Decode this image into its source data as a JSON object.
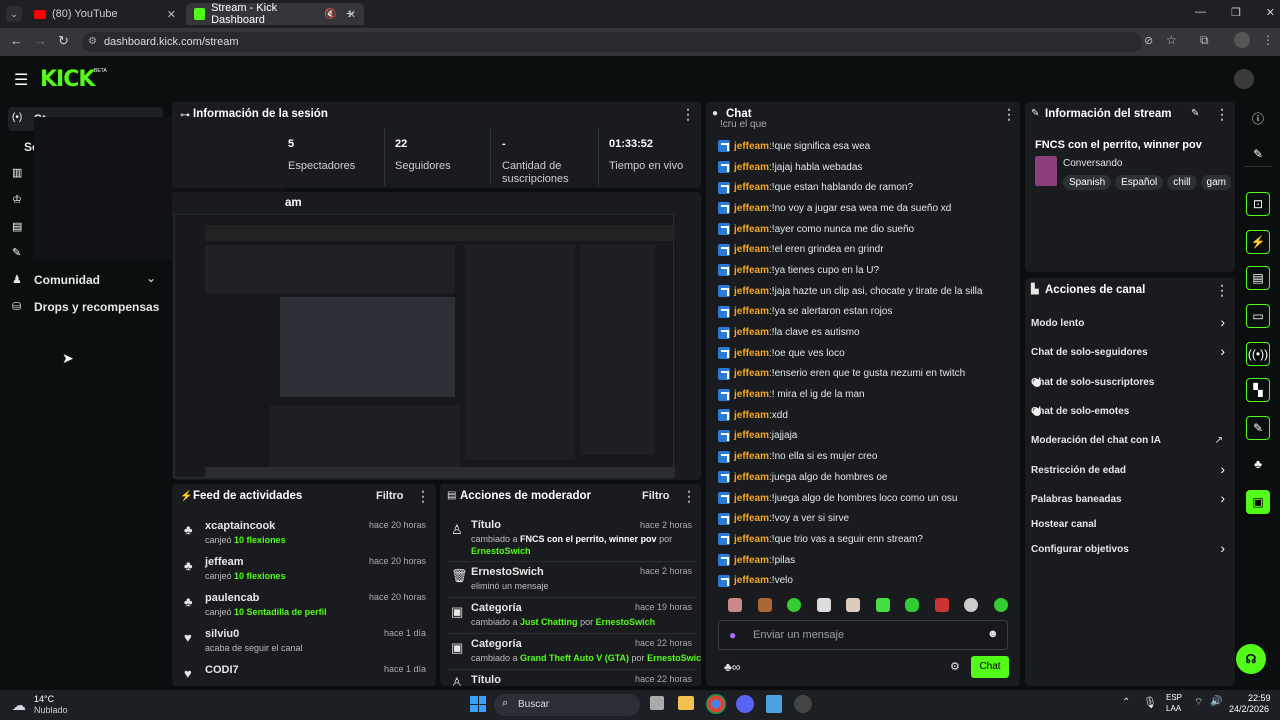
{
  "browser": {
    "tabs": [
      {
        "label": "(80) YouTube"
      },
      {
        "label": "Stream - Kick Dashboard"
      }
    ],
    "url": "dashboard.kick.com/stream"
  },
  "kick": {
    "logo": "KICK",
    "beta": "BETA"
  },
  "sidebar": {
    "items": [
      {
        "label": "St"
      },
      {
        "label": "Se"
      },
      {
        "label": "Comunidad"
      },
      {
        "label": "Drops y recompensas"
      }
    ]
  },
  "session": {
    "title": "Información de la sesión",
    "stats": [
      {
        "value": "5",
        "label": "Espectadores"
      },
      {
        "value": "22",
        "label": "Seguidores"
      },
      {
        "value": "-",
        "label": "Cantidad de suscripciones"
      },
      {
        "value": "01:33:52",
        "label": "Tiempo en vivo"
      }
    ],
    "stream_label": "am"
  },
  "feed": {
    "title": "Feed de actividades",
    "filter": "Filtro",
    "items": [
      {
        "name": "xcaptaincook",
        "action": "canjeó",
        "reward": "10 flexiones",
        "time": "hace 20 horas"
      },
      {
        "name": "jeffeam",
        "action": "canjeó",
        "reward": "10 flexiones",
        "time": "hace 20 horas"
      },
      {
        "name": "paulencab",
        "action": "canjeó",
        "reward": "10 Sentadilla de perfil",
        "time": "hace 20 horas"
      },
      {
        "name": "silviu0",
        "action": "acaba de seguir el canal",
        "reward": "",
        "time": "hace 1 día"
      },
      {
        "name": "CODI7",
        "action": "",
        "reward": "",
        "time": "hace 1 día"
      }
    ]
  },
  "mod": {
    "title": "Acciones de moderador",
    "filter": "Filtro",
    "items": [
      {
        "title": "Título",
        "time": "hace 2 horas",
        "line1": "cambiado a",
        "hl1": "FNCS con el perrito, winner pov",
        "mid": "por",
        "line2": "ErnestoSwich"
      },
      {
        "title": "ErnestoSwich",
        "time": "hace 2 horas",
        "line1": "eliminó un mensaje",
        "hl1": "",
        "mid": "",
        "line2": ""
      },
      {
        "title": "Categoría",
        "time": "hace 19 horas",
        "line1": "cambiado a",
        "hl1": "Just Chatting",
        "mid": "por",
        "line2": "ErnestoSwich"
      },
      {
        "title": "Categoría",
        "time": "hace 22 horas",
        "line1": "cambiado a",
        "hl1": "Grand Theft Auto V (GTA)",
        "mid": "por",
        "line2": "ErnestoSwich"
      },
      {
        "title": "Título",
        "time": "hace 22 horas",
        "line1": "",
        "hl1": "",
        "mid": "",
        "line2": ""
      }
    ]
  },
  "chat": {
    "title": "Chat",
    "first_partial": "!cru el que",
    "messages": [
      {
        "user": "jeffeam",
        "text": "!que significa esa wea"
      },
      {
        "user": "jeffeam",
        "text": "!jajaj habla webadas"
      },
      {
        "user": "jeffeam",
        "text": "!que estan hablando de ramon?"
      },
      {
        "user": "jeffeam",
        "text": "!no voy a jugar esa wea me da sueño xd"
      },
      {
        "user": "jeffeam",
        "text": "!ayer como nunca me dio sueño"
      },
      {
        "user": "jeffeam",
        "text": "!el eren grindea en grindr"
      },
      {
        "user": "jeffeam",
        "text": "!ya tienes cupo en la U?"
      },
      {
        "user": "jeffeam",
        "text": "!jaja hazte un clip asi, chocate y tirate de la silla"
      },
      {
        "user": "jeffeam",
        "text": "!ya se alertaron estan rojos"
      },
      {
        "user": "jeffeam",
        "text": "!la clave es autismo"
      },
      {
        "user": "jeffeam",
        "text": "!oe que ves loco"
      },
      {
        "user": "jeffeam",
        "text": "!enserio eren que te gusta nezumi en twitch"
      },
      {
        "user": "jeffeam",
        "text": "! mira el ig de la man"
      },
      {
        "user": "jeffeam",
        "text": "xdd"
      },
      {
        "user": "jeffeam",
        "text": "jajjaja"
      },
      {
        "user": "jeffeam",
        "text": "!no ella si es mujer creo"
      },
      {
        "user": "jeffeam",
        "text": "juega algo de hombres oe"
      },
      {
        "user": "jeffeam",
        "text": "!juega algo de hombres loco como un osu"
      },
      {
        "user": "jeffeam",
        "text": "!voy a ver si sirve"
      },
      {
        "user": "jeffeam",
        "text": "!que trio vas a seguir enn stream?"
      },
      {
        "user": "jeffeam",
        "text": "!pilas"
      },
      {
        "user": "jeffeam",
        "text": "!velo"
      }
    ],
    "placeholder": "Enviar un mensaje",
    "send": "Chat"
  },
  "streaminfo": {
    "title": "Información del stream",
    "stream_title": "FNCS con el perrito, winner pov",
    "category": "Conversando",
    "tags": [
      "Spanish",
      "Español",
      "chill",
      "gam"
    ]
  },
  "channel": {
    "title": "Acciones de canal",
    "items": [
      {
        "label": "Modo lento",
        "kind": "chevron"
      },
      {
        "label": "Chat de solo-seguidores",
        "kind": "chevron"
      },
      {
        "label": "Chat de solo-suscriptores",
        "kind": "toggle"
      },
      {
        "label": "Chat de solo-emotes",
        "kind": "toggle"
      },
      {
        "label": "Moderación del chat con IA",
        "kind": "external"
      },
      {
        "label": "Restricción de edad",
        "kind": "chevron"
      },
      {
        "label": "Palabras baneadas",
        "kind": "chevron"
      },
      {
        "label": "Hostear canal",
        "kind": "none"
      },
      {
        "label": "Configurar objetivos",
        "kind": "chevron"
      }
    ]
  },
  "taskbar": {
    "weather_temp": "14°C",
    "weather_desc": "Nublado",
    "search": "Buscar",
    "lang1": "ESP",
    "lang2": "LAA",
    "time": "22:59",
    "date": "24/2/2026"
  }
}
